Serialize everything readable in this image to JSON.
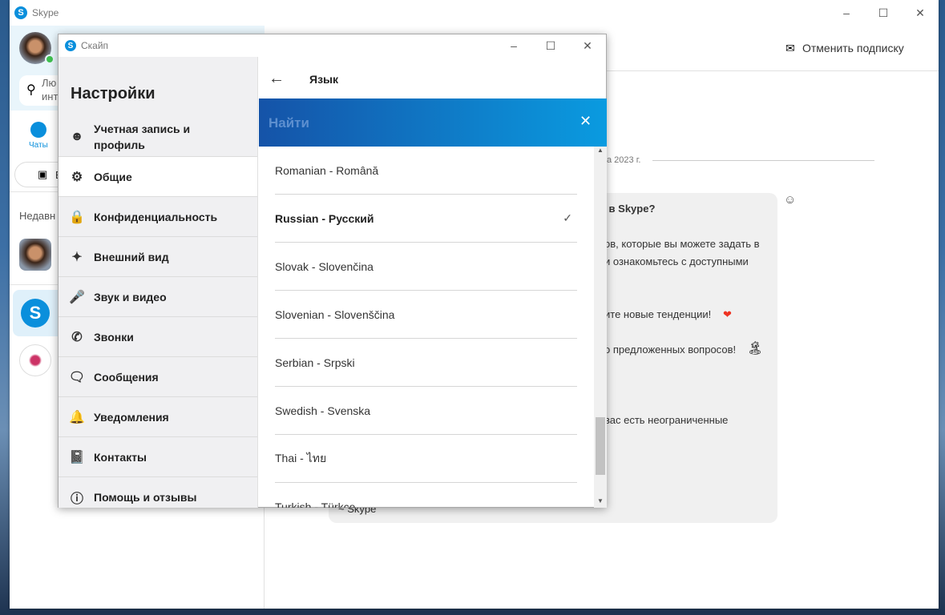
{
  "main_window": {
    "title": "Skype",
    "unsubscribe_label": "Отменить подписку",
    "search_placeholder_line1": "Лю",
    "search_placeholder_line2": "инт",
    "chats_label": "Чаты",
    "meet_button_fragment": "Б",
    "recent_fragment": "Недавн",
    "date_fragment": "а 2023 г."
  },
  "message": {
    "fragments": [
      "g в Skype?",
      "ов, которые вы можете задать в",
      "и ознакомьтесь с доступными",
      "ите новые тенденции!",
      "о предложенных вопросов!",
      "вас есть неограниченные",
      "~ Skype"
    ]
  },
  "dialog": {
    "title": "Скайп",
    "heading": "Настройки",
    "nav": [
      {
        "label": "Учетная запись и профиль",
        "icon": "person-icon"
      },
      {
        "label": "Общие",
        "icon": "gear-icon",
        "selected": true
      },
      {
        "label": "Конфиденциальность",
        "icon": "lock-icon"
      },
      {
        "label": "Внешний вид",
        "icon": "magic-wand-icon"
      },
      {
        "label": "Звук и видео",
        "icon": "microphone-icon"
      },
      {
        "label": "Звонки",
        "icon": "phone-icon"
      },
      {
        "label": "Сообщения",
        "icon": "message-icon"
      },
      {
        "label": "Уведомления",
        "icon": "bell-icon"
      },
      {
        "label": "Контакты",
        "icon": "contacts-icon"
      },
      {
        "label": "Помощь и отзывы",
        "icon": "info-icon"
      }
    ],
    "pane_title": "Язык",
    "search_placeholder": "Найти",
    "languages": [
      {
        "label": "Romanian - Română"
      },
      {
        "label": "Russian - Русский",
        "selected": true
      },
      {
        "label": "Slovak - Slovenčina"
      },
      {
        "label": "Slovenian - Slovenščina"
      },
      {
        "label": "Serbian - Srpski"
      },
      {
        "label": "Swedish - Svenska"
      },
      {
        "label": "Thai - ไทย"
      },
      {
        "label": "Turkish - Türkçe"
      }
    ]
  },
  "colors": {
    "accent": "#0a8fdc",
    "search_gradient_start": "#1553a8",
    "search_gradient_end": "#0a9be0"
  }
}
